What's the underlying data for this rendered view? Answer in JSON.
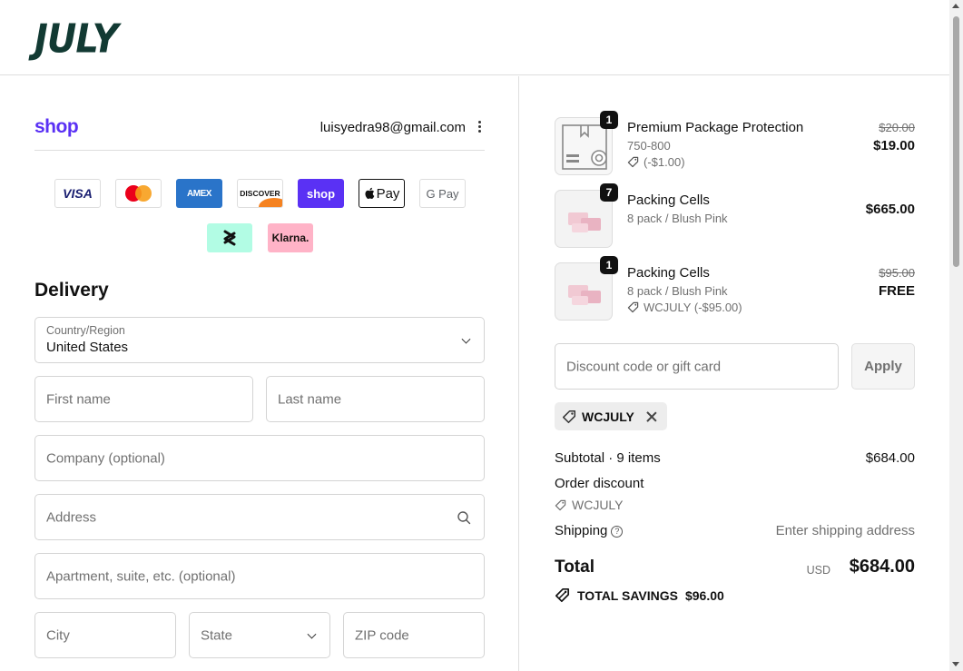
{
  "brand": {
    "logo_text": "JULY"
  },
  "shop_pay": {
    "logo_text": "shop",
    "email": "luisyedra98@gmail.com"
  },
  "payment_methods": {
    "visa": "VISA",
    "amex": "AMEX",
    "discover": "DISCOVER",
    "shop": "shop",
    "apple_pay": "Pay",
    "google_pay": "G Pay",
    "klarna": "Klarna."
  },
  "delivery": {
    "title": "Delivery",
    "country_label": "Country/Region",
    "country_value": "United States",
    "first_name_ph": "First name",
    "last_name_ph": "Last name",
    "company_ph": "Company (optional)",
    "address_ph": "Address",
    "apartment_ph": "Apartment, suite, etc. (optional)",
    "city_ph": "City",
    "state_ph": "State",
    "zip_ph": "ZIP code"
  },
  "cart": {
    "items": [
      {
        "qty": "1",
        "name": "Premium Package Protection",
        "variant": "750-800",
        "discount": "(-$1.00)",
        "original_price": "$20.00",
        "price": "$19.00"
      },
      {
        "qty": "7",
        "name": "Packing Cells",
        "variant": "8 pack / Blush Pink",
        "price": "$665.00"
      },
      {
        "qty": "1",
        "name": "Packing Cells",
        "variant": "8 pack / Blush Pink",
        "discount": "WCJULY (-$95.00)",
        "original_price": "$95.00",
        "price": "FREE"
      }
    ]
  },
  "discount": {
    "placeholder": "Discount code or gift card",
    "apply_label": "Apply",
    "applied_code": "WCJULY"
  },
  "summary": {
    "subtotal_label": "Subtotal · 9 items",
    "subtotal_value": "$684.00",
    "order_discount_label": "Order discount",
    "order_discount_code": "WCJULY",
    "shipping_label": "Shipping",
    "shipping_value": "Enter shipping address",
    "total_label": "Total",
    "currency": "USD",
    "total_value": "$684.00",
    "savings_label": "TOTAL SAVINGS",
    "savings_value": "$96.00"
  },
  "colors": {
    "brand": "#123a33",
    "shop_purple": "#5a31f4",
    "border": "#d4d4d4"
  }
}
